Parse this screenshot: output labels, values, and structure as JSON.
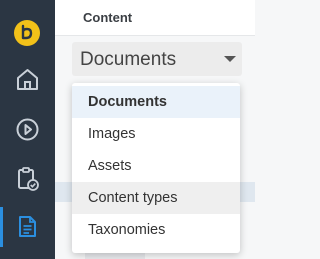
{
  "sidebar": {
    "items": [
      {
        "icon": "home-icon"
      },
      {
        "icon": "play-circle-icon"
      },
      {
        "icon": "clipboard-check-icon"
      },
      {
        "icon": "document-icon",
        "active": true
      }
    ],
    "logo_icon": "brand-logo-icon",
    "accent_color": "#2b8fe0"
  },
  "header": {
    "title": "Content"
  },
  "type_select": {
    "value": "Documents",
    "options": [
      "Documents",
      "Images",
      "Assets",
      "Content types",
      "Taxonomies"
    ],
    "selected_index": 0,
    "hovered_index": 3
  },
  "colors": {
    "sidebar_bg": "#2b3643",
    "logo": "#f2c119",
    "selected_item_bg": "#eaf2fa"
  }
}
